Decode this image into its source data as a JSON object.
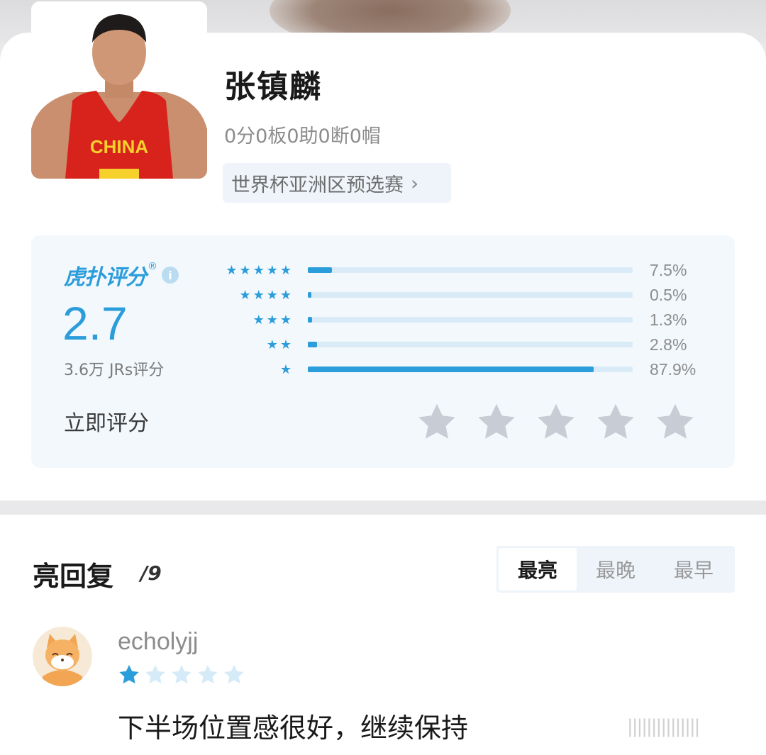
{
  "player": {
    "name": "张镇麟",
    "stats": "0分0板0助0断0帽",
    "tournament": "世界杯亚洲区预选赛",
    "jersey_text": "CHINA"
  },
  "rating": {
    "brand": "虎扑评分",
    "brand_reg": "®",
    "info_icon": "i",
    "score": "2.7",
    "raters": "3.6万 JRs评分",
    "rate_now": "立即评分",
    "distribution": [
      {
        "stars": 5,
        "percent": 7.5,
        "label": "7.5%"
      },
      {
        "stars": 4,
        "percent": 0.5,
        "label": "0.5%"
      },
      {
        "stars": 3,
        "percent": 1.3,
        "label": "1.3%"
      },
      {
        "stars": 2,
        "percent": 2.8,
        "label": "2.8%"
      },
      {
        "stars": 1,
        "percent": 87.9,
        "label": "87.9%"
      }
    ]
  },
  "replies": {
    "title": "亮回复",
    "count": "/9",
    "sort_tabs": [
      "最亮",
      "最晚",
      "最早"
    ],
    "active_tab": 0
  },
  "comment": {
    "username": "echolyjj",
    "rating_stars": 1,
    "text": "下半场位置感很好，继续保持",
    "avatar_icon": "fox-avatar"
  },
  "colors": {
    "accent": "#2b9ddb",
    "track": "#d9ebf7",
    "panel": "#f3f8fc",
    "star_empty": "#c8ccd4",
    "star_light": "#d6ebf8"
  }
}
